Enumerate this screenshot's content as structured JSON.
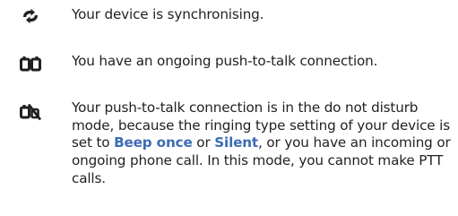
{
  "items": [
    {
      "icon": "sync-icon",
      "text": "Your device is synchronising."
    },
    {
      "icon": "ptt-connection-icon",
      "text": "You have an ongoing push-to-talk connection."
    },
    {
      "icon": "ptt-do-not-disturb-icon",
      "text_before": "Your push-to-talk connection is in the do not disturb mode, because the ringing type setting of your device is set to ",
      "link1": "Beep once",
      "text_middle": " or ",
      "link2": "Silent",
      "text_after": ", or you have an incoming or ongoing phone call. In this mode, you cannot make PTT calls."
    }
  ],
  "colors": {
    "text": "#231f20",
    "highlight": "#3c6cb4"
  }
}
